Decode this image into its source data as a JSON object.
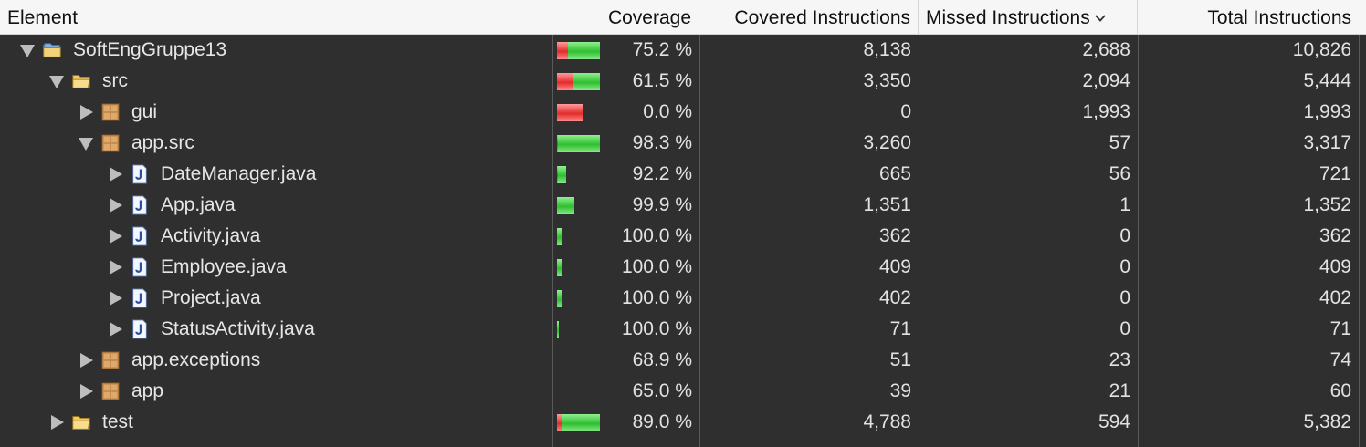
{
  "columns": {
    "element": "Element",
    "coverage": "Coverage",
    "covered": "Covered Instructions",
    "missed": "Missed Instructions",
    "total": "Total Instructions"
  },
  "sort_icon": "chevron-down-icon",
  "colors": {
    "header_bg": "#f6f6f6",
    "table_bg": "#2f2f2f",
    "covered": "#2fbf2f",
    "missed": "#e32b2b"
  },
  "rows": [
    {
      "name": "SoftEngGruppe13",
      "icon": "project-icon",
      "level": 0,
      "expanded": true,
      "coverage": "75.2 %",
      "covered": "8,138",
      "missed": "2,688",
      "total": "10,826",
      "covered_n": 8138,
      "missed_n": 2688
    },
    {
      "name": "src",
      "icon": "folder-icon",
      "level": 1,
      "expanded": true,
      "coverage": "61.5 %",
      "covered": "3,350",
      "missed": "2,094",
      "total": "5,444",
      "covered_n": 3350,
      "missed_n": 2094
    },
    {
      "name": "gui",
      "icon": "package-icon",
      "level": 2,
      "expanded": false,
      "coverage": "0.0 %",
      "covered": "0",
      "missed": "1,993",
      "total": "1,993",
      "covered_n": 0,
      "missed_n": 1993
    },
    {
      "name": "app.src",
      "icon": "package-icon",
      "level": 2,
      "expanded": true,
      "coverage": "98.3 %",
      "covered": "3,260",
      "missed": "57",
      "total": "3,317",
      "covered_n": 3260,
      "missed_n": 57
    },
    {
      "name": "DateManager.java",
      "icon": "java-file-icon",
      "level": 3,
      "expanded": false,
      "coverage": "92.2 %",
      "covered": "665",
      "missed": "56",
      "total": "721",
      "covered_n": 665,
      "missed_n": 56
    },
    {
      "name": "App.java",
      "icon": "java-file-icon",
      "level": 3,
      "expanded": false,
      "coverage": "99.9 %",
      "covered": "1,351",
      "missed": "1",
      "total": "1,352",
      "covered_n": 1351,
      "missed_n": 1
    },
    {
      "name": "Activity.java",
      "icon": "java-file-icon",
      "level": 3,
      "expanded": false,
      "coverage": "100.0 %",
      "covered": "362",
      "missed": "0",
      "total": "362",
      "covered_n": 362,
      "missed_n": 0
    },
    {
      "name": "Employee.java",
      "icon": "java-file-icon",
      "level": 3,
      "expanded": false,
      "coverage": "100.0 %",
      "covered": "409",
      "missed": "0",
      "total": "409",
      "covered_n": 409,
      "missed_n": 0
    },
    {
      "name": "Project.java",
      "icon": "java-file-icon",
      "level": 3,
      "expanded": false,
      "coverage": "100.0 %",
      "covered": "402",
      "missed": "0",
      "total": "402",
      "covered_n": 402,
      "missed_n": 0
    },
    {
      "name": "StatusActivity.java",
      "icon": "java-file-icon",
      "level": 3,
      "expanded": false,
      "coverage": "100.0 %",
      "covered": "71",
      "missed": "0",
      "total": "71",
      "covered_n": 71,
      "missed_n": 0
    },
    {
      "name": "app.exceptions",
      "icon": "package-icon",
      "level": 2,
      "expanded": false,
      "coverage": "68.9 %",
      "covered": "51",
      "missed": "23",
      "total": "74",
      "covered_n": 51,
      "missed_n": 23,
      "bar": false
    },
    {
      "name": "app",
      "icon": "package-icon",
      "level": 2,
      "expanded": false,
      "coverage": "65.0 %",
      "covered": "39",
      "missed": "21",
      "total": "60",
      "covered_n": 39,
      "missed_n": 21,
      "bar": false
    },
    {
      "name": "test",
      "icon": "folder-icon",
      "level": 1,
      "expanded": false,
      "coverage": "89.0 %",
      "covered": "4,788",
      "missed": "594",
      "total": "5,382",
      "covered_n": 4788,
      "missed_n": 594
    }
  ]
}
